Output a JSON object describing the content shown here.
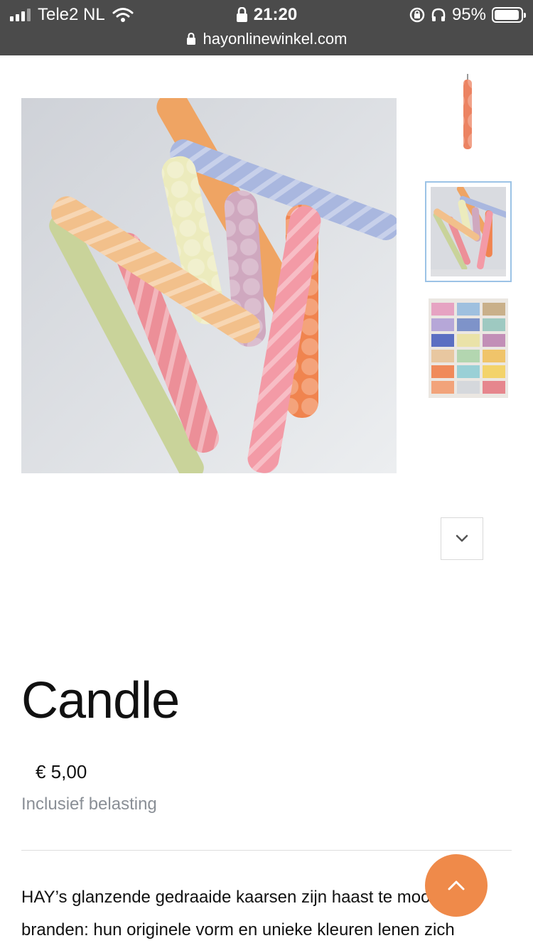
{
  "status_bar": {
    "carrier": "Tele2 NL",
    "time": "21:20",
    "battery_percent": "95%",
    "battery_level": 0.95,
    "url": "hayonlinewinkel.com"
  },
  "gallery": {
    "main_image": "product-photo-twisted-candles",
    "thumbnails": [
      "thumbnail-single-coral-candle",
      "thumbnail-twisted-candles",
      "thumbnail-candle-boxes"
    ],
    "selected_thumbnail": 2
  },
  "product": {
    "title": "Candle",
    "price": "€ 5,00",
    "tax_note": "Inclusief belasting",
    "description": "HAY’s glanzende gedraaide kaarsen zijn haast te mooi om te branden: hun originele vorm en unieke kleuren lenen zich"
  },
  "colors": {
    "status_bar_bg": "#4b4b4b",
    "accent_button": "#ef8a4a",
    "selected_thumb_border": "#9cc3e6",
    "muted_text": "#8a8f96"
  },
  "icons": {
    "scroll_down": "chevron-down-icon",
    "back_to_top": "chevron-up-icon"
  }
}
